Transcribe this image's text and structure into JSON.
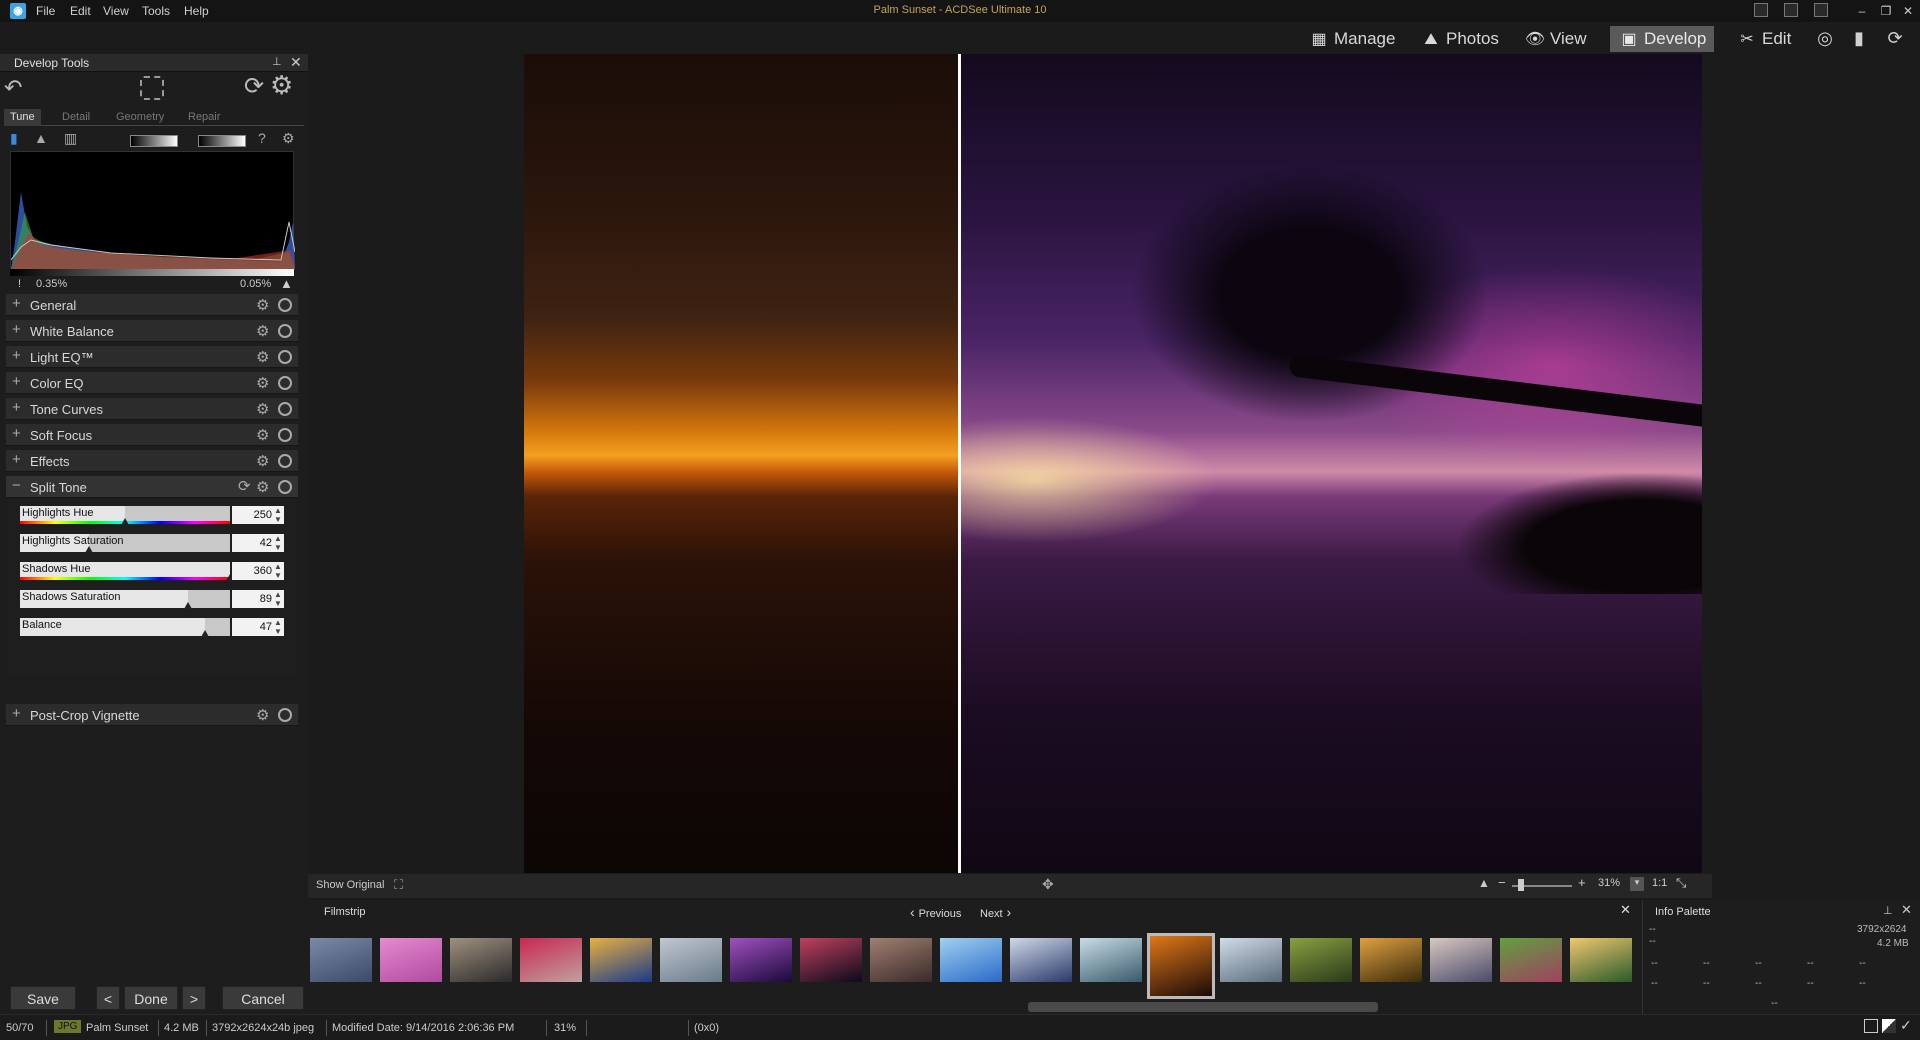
{
  "window": {
    "title": "Palm Sunset - ACDSee Ultimate 10",
    "logo": "acdsee-logo",
    "menu": [
      "File",
      "Edit",
      "View",
      "Tools",
      "Help"
    ]
  },
  "modes": [
    {
      "label": "Manage",
      "icon": "grid-icon"
    },
    {
      "label": "Photos",
      "icon": "photos-icon"
    },
    {
      "label": "View",
      "icon": "eye-icon"
    },
    {
      "label": "Develop",
      "icon": "develop-icon",
      "active": true
    },
    {
      "label": "Edit",
      "icon": "edit-icon"
    }
  ],
  "toolbar_icons": [
    "365-icon",
    "stats-icon",
    "eye-refresh-icon"
  ],
  "develop_tools": {
    "title": "Develop Tools",
    "tabs": [
      {
        "label": "Tune",
        "active": true
      },
      {
        "label": "Detail"
      },
      {
        "label": "Geometry"
      },
      {
        "label": "Repair"
      }
    ],
    "histogram": {
      "clip_low": "0.35%",
      "clip_high": "0.05%"
    },
    "groups": [
      {
        "label": "General",
        "expanded": false
      },
      {
        "label": "White Balance",
        "expanded": false
      },
      {
        "label": "Light EQ™",
        "expanded": false
      },
      {
        "label": "Color EQ",
        "expanded": false
      },
      {
        "label": "Tone Curves",
        "expanded": false
      },
      {
        "label": "Soft Focus",
        "expanded": false
      },
      {
        "label": "Effects",
        "expanded": false
      },
      {
        "label": "Split Tone",
        "expanded": true
      },
      {
        "label": "Post-Crop Vignette",
        "expanded": false
      }
    ],
    "split_tone": {
      "sliders": [
        {
          "label": "Highlights Hue",
          "value": "250",
          "level": 0.5,
          "hue": true
        },
        {
          "label": "Highlights Saturation",
          "value": "42",
          "level": 0.33,
          "hue": false
        },
        {
          "label": "Shadows Hue",
          "value": "360",
          "level": 1.0,
          "hue": true
        },
        {
          "label": "Shadows Saturation",
          "value": "89",
          "level": 0.8,
          "hue": false
        },
        {
          "label": "Balance",
          "value": "47",
          "level": 0.88,
          "hue": false
        }
      ]
    },
    "buttons": {
      "save": "Save",
      "done": "Done",
      "cancel": "Cancel",
      "prev": "<",
      "next": ">"
    }
  },
  "viewer": {
    "show_original": "Show Original",
    "zoom": "31%",
    "one_to_one": "1:1"
  },
  "filmstrip": {
    "title": "Filmstrip",
    "previous": "Previous",
    "next": "Next",
    "thumb_colors": [
      [
        "#3c4a6a",
        "#7a8aa6"
      ],
      [
        "#b04aa0",
        "#e68ad0"
      ],
      [
        "#2a2a2a",
        "#a09080"
      ],
      [
        "#c0a0a0",
        "#c82850"
      ],
      [
        "#1a3a8a",
        "#e8b040"
      ],
      [
        "#6a7a8a",
        "#c0c8d0"
      ],
      [
        "#1a0a3a",
        "#a050c0"
      ],
      [
        "#0a0a1a",
        "#c04060"
      ],
      [
        "#3a2a2a",
        "#a08070"
      ],
      [
        "#2a6ac8",
        "#a0d0f0"
      ],
      [
        "#2a3a6a",
        "#d0d8e8"
      ],
      [
        "#3a5a6a",
        "#c8dce8"
      ],
      [
        "#1a0a08",
        "#e07818"
      ],
      [
        "#5a6a7a",
        "#d0dce8"
      ],
      [
        "#2a3a1a",
        "#8aa040"
      ],
      [
        "#3a2a0a",
        "#e0a040"
      ],
      [
        "#4a4a6a",
        "#d8c8c0"
      ],
      [
        "#a04060",
        "#60a040"
      ],
      [
        "#2a5a2a",
        "#f0c870"
      ],
      [
        "#4a6a5a",
        "#b0c0b0"
      ]
    ],
    "selected_index": 12
  },
  "info_palette": {
    "title": "Info Palette",
    "dims": "3792x2624",
    "size": "4.2 MB",
    "placeholder": "--"
  },
  "status": {
    "index": "50/70",
    "format": "JPG",
    "name": "Palm Sunset",
    "size": "4.2 MB",
    "details": "3792x2624x24b jpeg",
    "modified": "Modified Date: 9/14/2016 2:06:36 PM",
    "zoom": "31%",
    "coords": "(0x0)"
  }
}
